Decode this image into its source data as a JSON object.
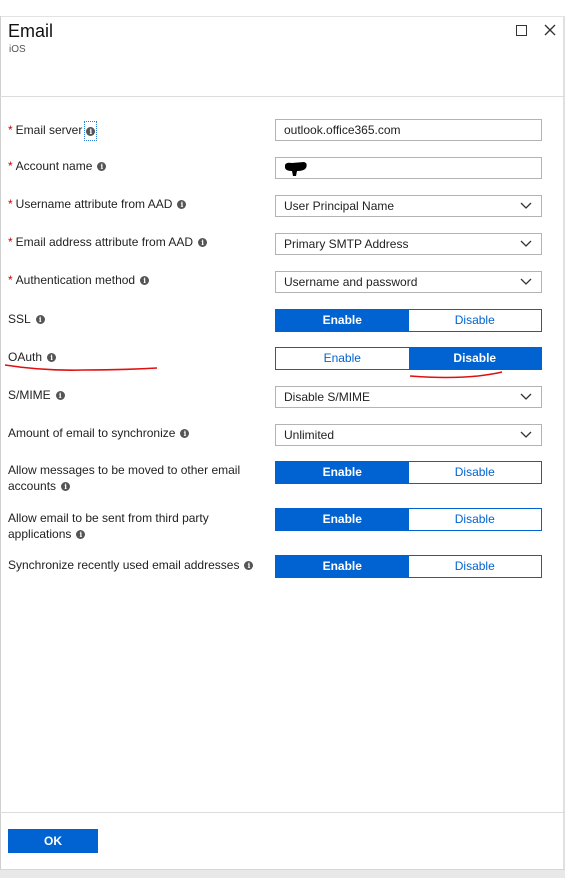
{
  "header": {
    "title": "Email",
    "subtitle": "iOS"
  },
  "fields": {
    "email_server": {
      "label": "Email server",
      "required": true,
      "value": "outlook.office365.com"
    },
    "account_name": {
      "label": "Account name",
      "required": true,
      "value": ""
    },
    "username_attr": {
      "label": "Username attribute from AAD",
      "required": true,
      "value": "User Principal Name"
    },
    "email_attr": {
      "label": "Email address attribute from AAD",
      "required": true,
      "value": "Primary SMTP Address"
    },
    "auth_method": {
      "label": "Authentication method",
      "required": true,
      "value": "Username and password"
    },
    "ssl": {
      "label": "SSL",
      "enable": "Enable",
      "disable": "Disable",
      "selected": "Enable"
    },
    "oauth": {
      "label": "OAuth",
      "enable": "Enable",
      "disable": "Disable",
      "selected": "Disable"
    },
    "smime": {
      "label": "S/MIME",
      "value": "Disable S/MIME"
    },
    "sync_amount": {
      "label": "Amount of email to synchronize",
      "value": "Unlimited"
    },
    "allow_move": {
      "label": "Allow messages to be moved to other email accounts",
      "enable": "Enable",
      "disable": "Disable",
      "selected": "Enable"
    },
    "third_party": {
      "label": "Allow email to be sent from third party applications",
      "enable": "Enable",
      "disable": "Disable",
      "selected": "Enable"
    },
    "sync_recent": {
      "label": "Synchronize recently used email addresses",
      "enable": "Enable",
      "disable": "Disable",
      "selected": "Enable"
    }
  },
  "footer": {
    "ok_label": "OK"
  },
  "colors": {
    "accent": "#0063d1",
    "required": "#c00000",
    "annotation": "#e01010"
  },
  "icons": {
    "info": "info-icon",
    "maximize": "maximize-icon",
    "close": "close-icon",
    "dropdown": "chevron-down-icon"
  }
}
